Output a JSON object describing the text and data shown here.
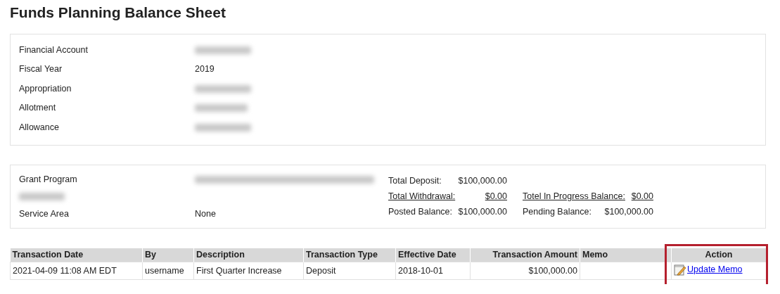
{
  "title": "Funds Planning Balance Sheet",
  "account_panel": {
    "fields": [
      {
        "label": "Financial Account",
        "redacted": true
      },
      {
        "label": "Fiscal Year",
        "value": "2019",
        "redacted": false
      },
      {
        "label": "Appropriation",
        "redacted": true
      },
      {
        "label": "Allotment",
        "redacted": true
      },
      {
        "label": "Allowance",
        "redacted": true
      }
    ]
  },
  "grant_panel": {
    "fields": [
      {
        "label": "Grant Program",
        "redacted": true
      },
      {
        "label": "Service Area",
        "value": "None",
        "redacted": false
      }
    ],
    "summary": [
      [
        {
          "label": "Total Deposit:",
          "value": "$100,000.00",
          "link": false
        }
      ],
      [
        {
          "label": "Total Withdrawal:",
          "value": "$0.00",
          "link": true
        },
        {
          "label": "Totel In Progress Balance:",
          "value": "$0.00",
          "link": true
        }
      ],
      [
        {
          "label": "Posted Balance:",
          "value": "$100,000.00",
          "link": false
        },
        {
          "label": "Pending Balance:",
          "value": "$100,000.00",
          "link": false
        }
      ]
    ]
  },
  "table": {
    "columns": [
      {
        "label": "Transaction Date",
        "kind": "text",
        "highlighted": false
      },
      {
        "label": "By",
        "kind": "text",
        "highlighted": false
      },
      {
        "label": "Description",
        "kind": "text",
        "highlighted": false
      },
      {
        "label": "Transaction Type",
        "kind": "text",
        "highlighted": false
      },
      {
        "label": "Effective Date",
        "kind": "text",
        "highlighted": false
      },
      {
        "label": "Transaction Amount",
        "kind": "amount",
        "highlighted": false
      },
      {
        "label": "Memo",
        "kind": "text",
        "highlighted": false
      },
      {
        "label": "Action",
        "kind": "action",
        "highlighted": true
      }
    ],
    "rows": [
      {
        "cells": [
          "2021-04-09 11:08 AM EDT",
          "username",
          "First Quarter Increase",
          "Deposit",
          "2018-10-01",
          "$100,000.00",
          null
        ],
        "action": "Update Memo"
      }
    ]
  }
}
